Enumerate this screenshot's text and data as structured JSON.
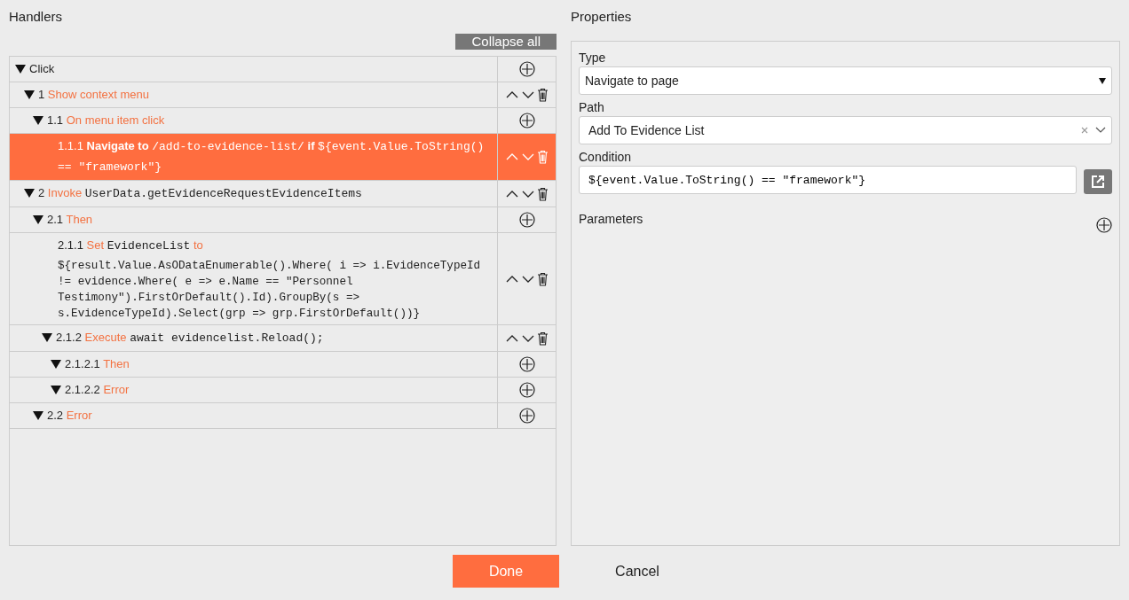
{
  "handlers": {
    "title": "Handlers",
    "collapse_button": "Collapse all",
    "tree": [
      {
        "parts": [
          {
            "kind": "plain",
            "text": "Click"
          }
        ],
        "kind": "branch",
        "movable": false,
        "selected": false,
        "children": [
          {
            "number": "1",
            "parts": [
              {
                "kind": "keyword",
                "text": "Show context menu"
              }
            ],
            "kind": "branch",
            "movable": true,
            "selected": false,
            "children": [
              {
                "number": "1.1",
                "parts": [
                  {
                    "kind": "keyword",
                    "text": "On menu item click"
                  }
                ],
                "kind": "branch",
                "movable": false,
                "selected": false,
                "children": [
                  {
                    "number": "1.1.1",
                    "parts": [
                      {
                        "kind": "keyword",
                        "text": "Navigate to"
                      },
                      {
                        "kind": "code",
                        "text": "/add-to-evidence-list/"
                      },
                      {
                        "kind": "keyword",
                        "text": "if"
                      },
                      {
                        "kind": "code",
                        "text": "${event.Value.ToString() == \"framework\"}"
                      }
                    ],
                    "kind": "leaf",
                    "movable": true,
                    "selected": true
                  }
                ]
              }
            ]
          },
          {
            "number": "2",
            "parts": [
              {
                "kind": "keyword",
                "text": "Invoke"
              },
              {
                "kind": "code",
                "text": "UserData.getEvidenceRequestEvidenceItems"
              }
            ],
            "kind": "branch",
            "movable": true,
            "selected": false,
            "children": [
              {
                "number": "2.1",
                "parts": [
                  {
                    "kind": "keyword",
                    "text": "Then"
                  }
                ],
                "kind": "branch",
                "movable": false,
                "selected": false,
                "children": [
                  {
                    "number": "2.1.1",
                    "parts": [
                      {
                        "kind": "keyword",
                        "text": "Set"
                      },
                      {
                        "kind": "code",
                        "text": "EvidenceList"
                      },
                      {
                        "kind": "keyword",
                        "text": "to"
                      },
                      {
                        "kind": "code-block",
                        "text": "${result.Value.AsODataEnumerable().Where( i => i.EvidenceTypeId != evidence.Where( e => e.Name == \"Personnel Testimony\").FirstOrDefault().Id).GroupBy(s => s.EvidenceTypeId).Select(grp => grp.FirstOrDefault())}"
                      }
                    ],
                    "kind": "leaf",
                    "movable": true,
                    "selected": false
                  },
                  {
                    "number": "2.1.2",
                    "parts": [
                      {
                        "kind": "keyword",
                        "text": "Execute"
                      },
                      {
                        "kind": "code",
                        "text": "await evidencelist.Reload();"
                      }
                    ],
                    "kind": "branch",
                    "movable": true,
                    "selected": false,
                    "children": [
                      {
                        "number": "2.1.2.1",
                        "parts": [
                          {
                            "kind": "keyword",
                            "text": "Then"
                          }
                        ],
                        "kind": "branch",
                        "movable": false,
                        "selected": false
                      },
                      {
                        "number": "2.1.2.2",
                        "parts": [
                          {
                            "kind": "keyword",
                            "text": "Error"
                          }
                        ],
                        "kind": "branch",
                        "movable": false,
                        "selected": false
                      }
                    ]
                  }
                ]
              },
              {
                "number": "2.2",
                "parts": [
                  {
                    "kind": "keyword",
                    "text": "Error"
                  }
                ],
                "kind": "branch",
                "movable": false,
                "selected": false
              }
            ]
          }
        ]
      }
    ]
  },
  "properties": {
    "title": "Properties",
    "fields": [
      {
        "kind": "select",
        "label": "Type",
        "value": "Navigate to page"
      },
      {
        "kind": "combo",
        "label": "Path",
        "value": "Add To Evidence List"
      },
      {
        "kind": "code",
        "label": "Condition",
        "value": "${event.Value.ToString() == \"framework\"}"
      }
    ],
    "parameters": {
      "label": "Parameters"
    }
  },
  "footer": {
    "buttons": [
      {
        "label": "Done",
        "kind": "primary"
      },
      {
        "label": "Cancel",
        "kind": "link"
      }
    ]
  }
}
